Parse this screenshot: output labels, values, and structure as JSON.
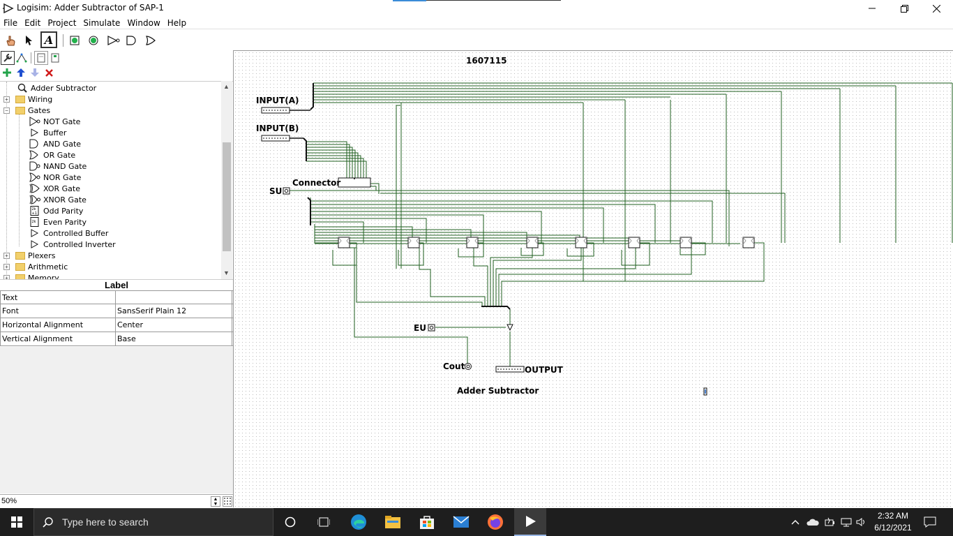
{
  "window": {
    "title": "Logisim: Adder Subtractor of SAP-1",
    "controls": [
      "minimize-icon",
      "maximize-icon",
      "close-icon"
    ]
  },
  "menu": [
    "File",
    "Edit",
    "Project",
    "Simulate",
    "Window",
    "Help"
  ],
  "toolbar": {
    "tools": [
      "poke-tool-icon",
      "select-tool-icon",
      "text-tool-icon",
      "input-pin-icon",
      "output-pin-icon",
      "not-gate-icon",
      "and-gate-icon",
      "or-gate-icon"
    ],
    "text_tool_label": "A"
  },
  "explorer": {
    "items": [
      {
        "label": "Adder Subtractor",
        "kind": "circuit",
        "depth": 1
      },
      {
        "label": "Wiring",
        "kind": "folder",
        "depth": 0,
        "expander": "+"
      },
      {
        "label": "Gates",
        "kind": "folder",
        "depth": 0,
        "expander": "-"
      },
      {
        "label": "NOT Gate",
        "kind": "gate",
        "depth": 1,
        "icon": "not-gate-icon"
      },
      {
        "label": "Buffer",
        "kind": "gate",
        "depth": 1,
        "icon": "buffer-icon"
      },
      {
        "label": "AND Gate",
        "kind": "gate",
        "depth": 1,
        "icon": "and-gate-icon"
      },
      {
        "label": "OR Gate",
        "kind": "gate",
        "depth": 1,
        "icon": "or-gate-icon"
      },
      {
        "label": "NAND Gate",
        "kind": "gate",
        "depth": 1,
        "icon": "nand-gate-icon"
      },
      {
        "label": "NOR Gate",
        "kind": "gate",
        "depth": 1,
        "icon": "nor-gate-icon"
      },
      {
        "label": "XOR Gate",
        "kind": "gate",
        "depth": 1,
        "icon": "xor-gate-icon"
      },
      {
        "label": "XNOR Gate",
        "kind": "gate",
        "depth": 1,
        "icon": "xnor-gate-icon"
      },
      {
        "label": "Odd Parity",
        "kind": "gate",
        "depth": 1,
        "icon": "odd-parity-icon"
      },
      {
        "label": "Even Parity",
        "kind": "gate",
        "depth": 1,
        "icon": "even-parity-icon"
      },
      {
        "label": "Controlled Buffer",
        "kind": "gate",
        "depth": 1,
        "icon": "controlled-buffer-icon"
      },
      {
        "label": "Controlled Inverter",
        "kind": "gate",
        "depth": 1,
        "icon": "controlled-inverter-icon"
      },
      {
        "label": "Plexers",
        "kind": "folder",
        "depth": 0,
        "expander": "+"
      },
      {
        "label": "Arithmetic",
        "kind": "folder",
        "depth": 0,
        "expander": "+"
      },
      {
        "label": "Memory",
        "kind": "folder",
        "depth": 0,
        "expander": "+"
      }
    ]
  },
  "properties": {
    "title": "Label",
    "rows": [
      {
        "key": "Text",
        "value": ""
      },
      {
        "key": "Font",
        "value": "SansSerif Plain 12"
      },
      {
        "key": "Horizontal Alignment",
        "value": "Center"
      },
      {
        "key": "Vertical Alignment",
        "value": "Base"
      }
    ]
  },
  "zoom": "50%",
  "canvas": {
    "labels": {
      "id": "1607115",
      "input_a": "INPUT(A)",
      "input_b": "INPUT(B)",
      "connector": "Connector",
      "su": "SU",
      "eu": "EU",
      "cout": "Cout",
      "output": "OUTPUT",
      "circuit_name": "Adder Subtractor"
    },
    "wire_color": "#1f5f1f"
  },
  "taskbar": {
    "search_placeholder": "Type here to search",
    "time": "2:32 AM",
    "date": "6/12/2021",
    "apps": [
      "windows-start-icon",
      "cortana-icon",
      "task-view-icon",
      "edge-icon",
      "file-explorer-icon",
      "store-icon",
      "mail-icon",
      "firefox-icon",
      "logisim-icon"
    ],
    "tray": [
      "chevron-up-icon",
      "onedrive-icon",
      "battery-icon",
      "network-icon",
      "volume-icon",
      "notification-icon"
    ]
  }
}
